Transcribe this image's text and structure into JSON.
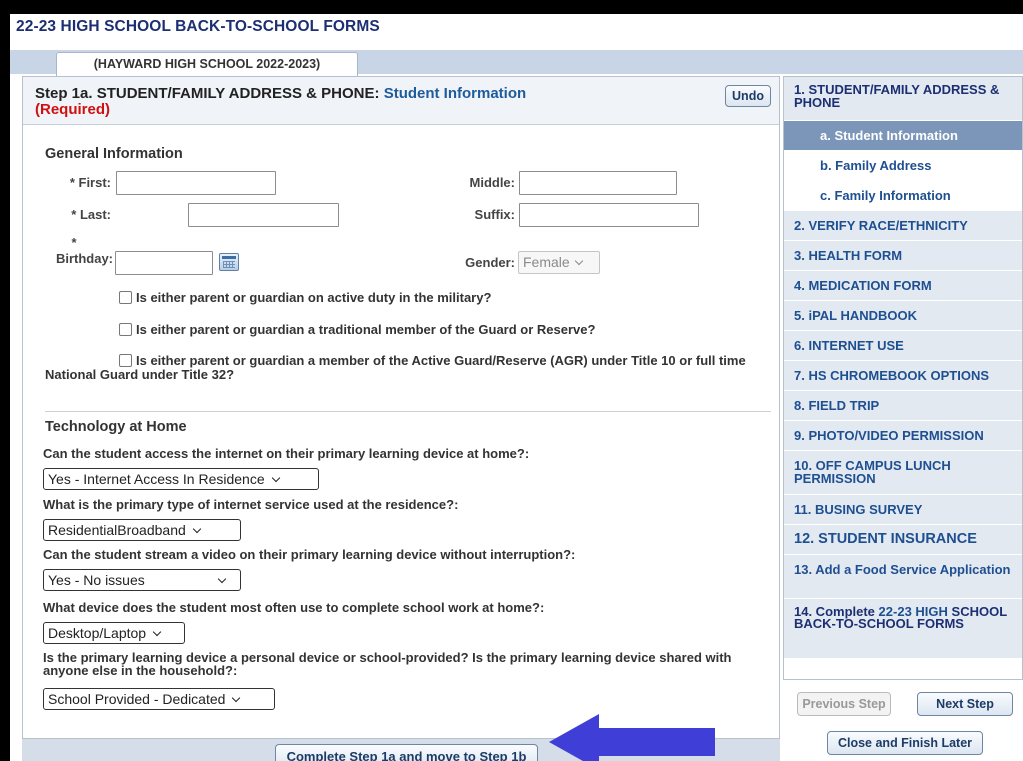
{
  "app": {
    "title": "22-23 HIGH SCHOOL BACK-TO-SCHOOL FORMS",
    "tab_label": "(HAYWARD HIGH SCHOOL 2022-2023)"
  },
  "step": {
    "title_prefix": "Step 1a. STUDENT/FAMILY ADDRESS & PHONE:",
    "title_sub": "Student Information",
    "required": "(Required)",
    "undo_label": "Undo"
  },
  "general": {
    "heading": "General Information",
    "first_label": "First:",
    "middle_label": "Middle:",
    "last_label": "Last:",
    "suffix_label": "Suffix:",
    "birthday_label": "Birthday:",
    "gender_label": "Gender:",
    "gender_value": "Female",
    "required_mark": "*",
    "checkboxes": [
      "Is either parent or guardian on active duty in the military?",
      "Is either parent or guardian a traditional member of the Guard or Reserve?",
      "Is either parent or guardian a member of the Active Guard/Reserve (AGR) under Title 10 or full time National Guard under Title 32?"
    ]
  },
  "technology": {
    "heading": "Technology at Home",
    "questions": [
      {
        "label": "Can the student access the internet on their primary learning device at home?:",
        "value": "Yes - Internet Access In Residence"
      },
      {
        "label": "What is the primary type of internet service used at the residence?:",
        "value": "ResidentialBroadband"
      },
      {
        "label": "Can the student stream a video on their primary learning device without interruption?:",
        "value": "Yes - No issues"
      },
      {
        "label": "What device does the student most often use to complete school work at home?:",
        "value": "Desktop/Laptop"
      },
      {
        "label": "Is the primary learning device a personal device or school-provided? Is the primary learning device shared with anyone else in the household?:",
        "value": "School Provided - Dedicated"
      }
    ]
  },
  "footer": {
    "complete_label": "Complete Step 1a and move to Step 1b"
  },
  "sidebar": {
    "items": [
      {
        "label": "1. STUDENT/FAMILY ADDRESS & PHONE"
      },
      {
        "label": "a. Student Information"
      },
      {
        "label": "b. Family Address"
      },
      {
        "label": "c. Family Information"
      },
      {
        "label": "2. VERIFY RACE/ETHNICITY"
      },
      {
        "label": "3. HEALTH FORM"
      },
      {
        "label": "4. MEDICATION FORM"
      },
      {
        "label": "5. iPAL HANDBOOK"
      },
      {
        "label": "6. INTERNET USE"
      },
      {
        "label": "7. HS CHROMEBOOK OPTIONS"
      },
      {
        "label": "8. FIELD TRIP"
      },
      {
        "label": "9. PHOTO/VIDEO PERMISSION"
      },
      {
        "label": "10. OFF CAMPUS LUNCH PERMISSION"
      },
      {
        "label": "11. BUSING SURVEY"
      },
      {
        "label": "12. STUDENT INSURANCE"
      },
      {
        "label": "13. Add a Food Service Application"
      }
    ],
    "final_prefix": "14. Complete",
    "final_highlight": "22-23 HIGH",
    "final_suffix": "SCHOOL BACK-TO-SCHOOL FORMS",
    "prev_label": "Previous Step",
    "next_label": "Next Step",
    "close_label": "Close and Finish Later"
  },
  "colors": {
    "title_navy": "#1c2f73",
    "link_blue": "#1e4f91",
    "required_red": "#d01010",
    "active_nav": "#7b96b9",
    "arrow_blue": "#3f3fd8"
  }
}
